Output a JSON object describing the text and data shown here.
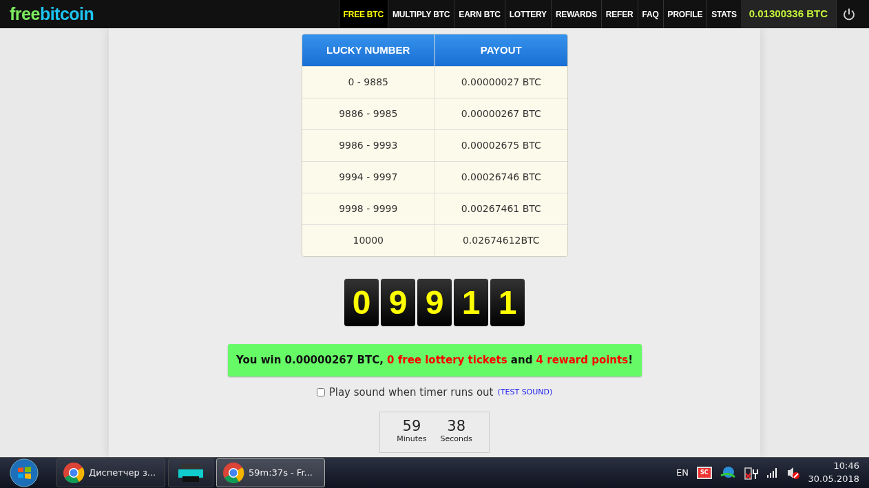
{
  "logo": {
    "part1": "free",
    "part2": "bitcoin"
  },
  "nav": [
    {
      "label": "FREE BTC",
      "selected": true
    },
    {
      "label": "MULTIPLY BTC",
      "selected": false
    },
    {
      "label": "EARN BTC",
      "selected": false
    },
    {
      "label": "LOTTERY",
      "selected": false
    },
    {
      "label": "REWARDS",
      "selected": false
    },
    {
      "label": "REFER",
      "selected": false
    },
    {
      "label": "FAQ",
      "selected": false
    },
    {
      "label": "PROFILE",
      "selected": false
    },
    {
      "label": "STATS",
      "selected": false
    }
  ],
  "balance": "0.01300336 BTC",
  "payout_table": {
    "columns": [
      "LUCKY NUMBER",
      "PAYOUT"
    ],
    "rows": [
      [
        "0 - 9885",
        "0.00000027 BTC"
      ],
      [
        "9886 - 9985",
        "0.00000267 BTC"
      ],
      [
        "9986 - 9993",
        "0.00002675 BTC"
      ],
      [
        "9994 - 9997",
        "0.00026746 BTC"
      ],
      [
        "9998 - 9999",
        "0.00267461 BTC"
      ],
      [
        "10000",
        "0.02674612BTC"
      ]
    ]
  },
  "lucky_digits": [
    "0",
    "9",
    "9",
    "1",
    "1"
  ],
  "win_message": [
    {
      "text": "You win 0.00000267 BTC, ",
      "highlight": false
    },
    {
      "text": "0 free lottery tickets",
      "highlight": true
    },
    {
      "text": " and ",
      "highlight": false
    },
    {
      "text": "4 reward points",
      "highlight": true
    },
    {
      "text": "!",
      "highlight": false
    }
  ],
  "sound_option": {
    "label": "Play sound when timer runs out",
    "checked": false,
    "link": "(TEST SOUND)"
  },
  "timer": [
    {
      "value": "59",
      "unit": "Minutes"
    },
    {
      "value": "38",
      "unit": "Seconds"
    }
  ],
  "taskbar": {
    "items": [
      {
        "label": "Диспетчер з...",
        "kind": "chrome",
        "selected": false
      },
      {
        "kind": "printer",
        "selected": false
      },
      {
        "label": "59m:37s - Fr...",
        "kind": "chrome",
        "selected": true
      }
    ],
    "language": "EN",
    "tray_badge": "SC",
    "time": "10:46",
    "date": "30.05.2018"
  }
}
